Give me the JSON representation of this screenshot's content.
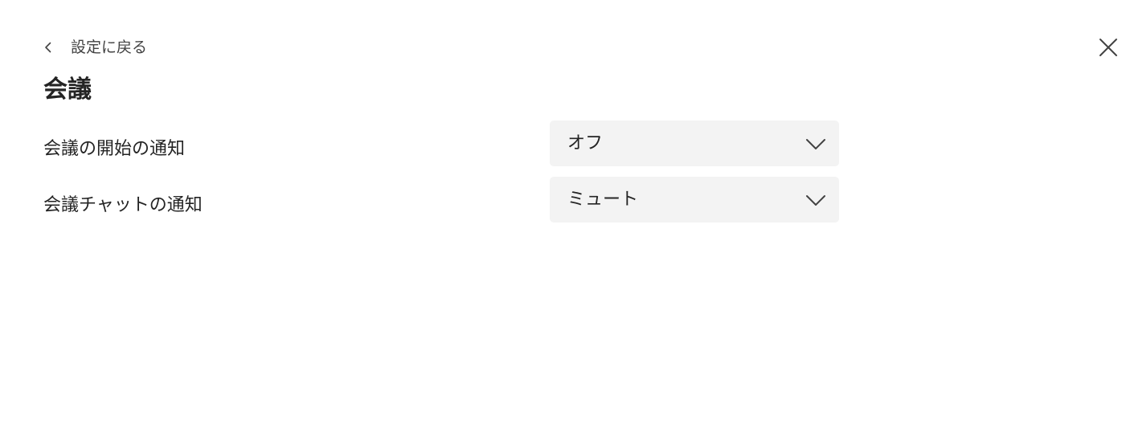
{
  "nav": {
    "back_label": "設定に戻る"
  },
  "page": {
    "title": "会議"
  },
  "settings": [
    {
      "label": "会議の開始の通知",
      "value": "オフ"
    },
    {
      "label": "会議チャットの通知",
      "value": "ミュート"
    }
  ],
  "icons": {
    "back": "chevron-left-icon",
    "close": "close-icon",
    "dropdown": "chevron-down-icon"
  },
  "colors": {
    "text": "#242424",
    "dropdown_bg": "#f3f3f3",
    "background": "#ffffff"
  }
}
